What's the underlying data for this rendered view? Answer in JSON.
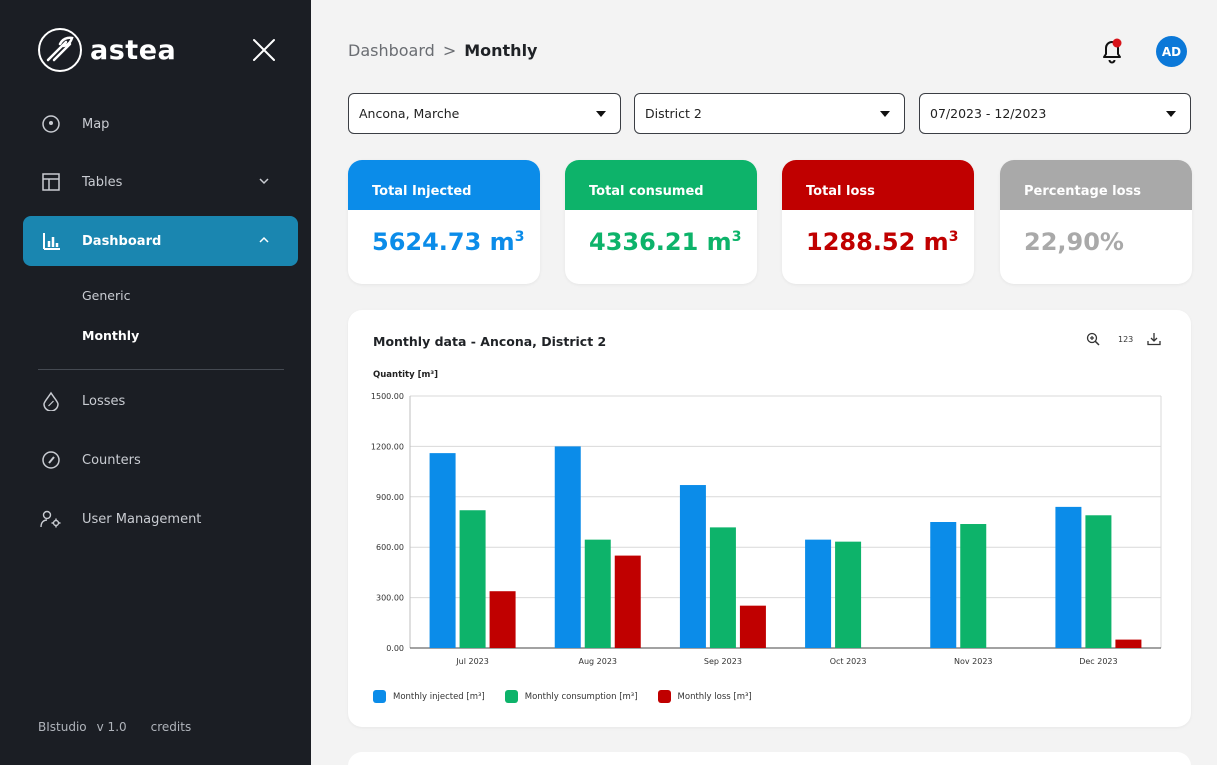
{
  "sidebar": {
    "brand": "astea",
    "items": [
      {
        "label": "Map",
        "icon": "map-pin-icon"
      },
      {
        "label": "Tables",
        "icon": "table-icon"
      },
      {
        "label": "Dashboard",
        "icon": "bar-chart-icon"
      },
      {
        "label": "Losses",
        "icon": "drop-percent-icon"
      },
      {
        "label": "Counters",
        "icon": "gauge-icon"
      },
      {
        "label": "User Management",
        "icon": "user-settings-icon"
      }
    ],
    "submenu": [
      {
        "label": "Generic"
      },
      {
        "label": "Monthly"
      }
    ],
    "footer": {
      "app": "BIstudio",
      "version": "v 1.0",
      "credits": "credits"
    }
  },
  "header": {
    "breadcrumb_root": "Dashboard",
    "breadcrumb_sep": ">",
    "breadcrumb_current": "Monthly",
    "avatar_initials": "AD"
  },
  "filters": {
    "location": "Ancona, Marche",
    "district": "District 2",
    "period": "07/2023 - 12/2023"
  },
  "kpis": [
    {
      "title": "Total Injected",
      "value": "5624.73 m",
      "unit_sup": "3",
      "color": "#0b8ce9"
    },
    {
      "title": "Total consumed",
      "value": "4336.21 m",
      "unit_sup": "3",
      "color": "#0db36a"
    },
    {
      "title": "Total loss",
      "value": "1288.52 m",
      "unit_sup": "3",
      "color": "#c00000"
    },
    {
      "title": "Percentage loss",
      "value": "22,90%",
      "unit_sup": "",
      "color": "#a9a9a9"
    }
  ],
  "chart": {
    "title": "Monthly data - Ancona, District 2",
    "tool_numbers": "123"
  },
  "chart_data": {
    "type": "bar",
    "ylabel": "Quantity [m³]",
    "ylim": [
      0,
      1500
    ],
    "yticks": [
      "0.00",
      "300.00",
      "600.00",
      "900.00",
      "1200.00",
      "1500.00"
    ],
    "categories": [
      "Jul 2023",
      "Aug 2023",
      "Sep 2023",
      "Oct 2023",
      "Nov 2023",
      "Dec 2023"
    ],
    "series": [
      {
        "name": "Monthly injected [m³]",
        "color": "#0b8ce9",
        "values": [
          1160,
          1200,
          970,
          645,
          750,
          840
        ]
      },
      {
        "name": "Monthly consumption [m³]",
        "color": "#0db36a",
        "values": [
          820,
          645,
          718,
          633,
          738,
          790
        ]
      },
      {
        "name": "Monthly loss [m³]",
        "color": "#c00000",
        "values": [
          338,
          550,
          252,
          0,
          0,
          50
        ]
      }
    ],
    "grid": true,
    "legend_position": "bottom-left"
  }
}
